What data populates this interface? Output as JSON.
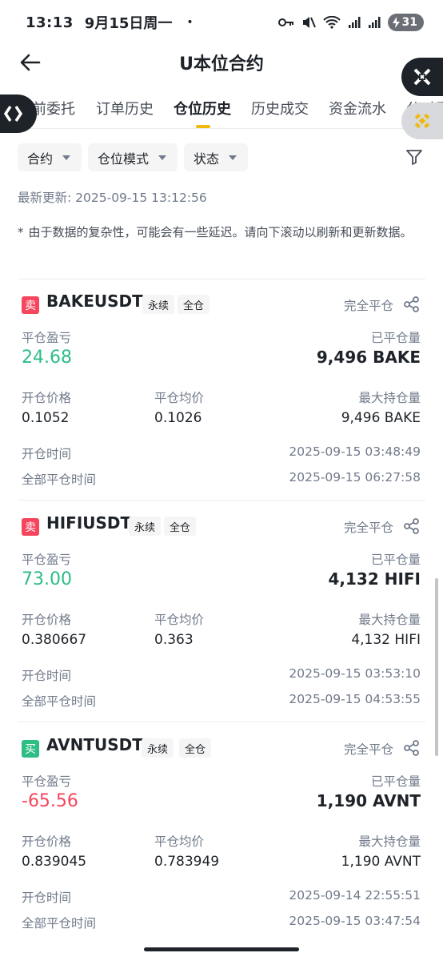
{
  "status_bar": {
    "time": "13:13",
    "date": "9月15日周一",
    "dot": "•",
    "battery": "31"
  },
  "header": {
    "title": "U本位合约"
  },
  "tabs": [
    {
      "label": "前委托"
    },
    {
      "label": "订单历史"
    },
    {
      "label": "仓位历史",
      "active": true
    },
    {
      "label": "历史成交"
    },
    {
      "label": "资金流水"
    },
    {
      "label": "分时委"
    }
  ],
  "filters": {
    "contract": "合约",
    "position_mode": "仓位模式",
    "status": "状态"
  },
  "last_update": "最新更新: 2025-09-15 13:12:56",
  "notice": {
    "star": "*",
    "text": "由于数据的复杂性，可能会有一些延迟。请向下滚动以刷新和更新数据。"
  },
  "labels": {
    "close_pnl": "平仓盈亏",
    "closed_qty": "已平仓量",
    "open_price": "开仓价格",
    "close_avg": "平仓均价",
    "max_hold": "最大持仓量",
    "open_time": "开仓时间",
    "full_close_time": "全部平仓时间",
    "close_all": "完全平仓"
  },
  "colors": {
    "sell": "#f6465d",
    "buy": "#2ebd85",
    "accent": "#f0b90b"
  },
  "positions": [
    {
      "side": "卖",
      "side_type": "sell",
      "symbol": "BAKEUSDT",
      "tag1": "永续",
      "tag2": "全仓",
      "pnl": "24.68",
      "pnl_type": "buy",
      "closed_qty": "9,496 BAKE",
      "open_price": "0.1052",
      "close_avg": "0.1026",
      "max_hold": "9,496 BAKE",
      "open_time": "2025-09-15 03:48:49",
      "full_close_time": "2025-09-15 06:27:58"
    },
    {
      "side": "卖",
      "side_type": "sell",
      "symbol": "HIFIUSDT",
      "tag1": "永续",
      "tag2": "全仓",
      "pnl": "73.00",
      "pnl_type": "buy",
      "closed_qty": "4,132 HIFI",
      "open_price": "0.380667",
      "close_avg": "0.363",
      "max_hold": "4,132 HIFI",
      "open_time": "2025-09-15 03:53:10",
      "full_close_time": "2025-09-15 04:53:55"
    },
    {
      "side": "买",
      "side_type": "buy",
      "symbol": "AVNTUSDT",
      "tag1": "永续",
      "tag2": "全仓",
      "pnl": "-65.56",
      "pnl_type": "sell",
      "closed_qty": "1,190 AVNT",
      "open_price": "0.839045",
      "close_avg": "0.783949",
      "max_hold": "1,190 AVNT",
      "open_time": "2025-09-14 22:55:51",
      "full_close_time": "2025-09-15 03:47:54"
    }
  ],
  "icons": {
    "back": "arrow-left-icon",
    "filter": "funnel-icon",
    "share": "share-icon",
    "float_left": "swap-logo-icon",
    "float_x": "x-logo-icon",
    "float_bnb": "binance-logo-icon"
  }
}
